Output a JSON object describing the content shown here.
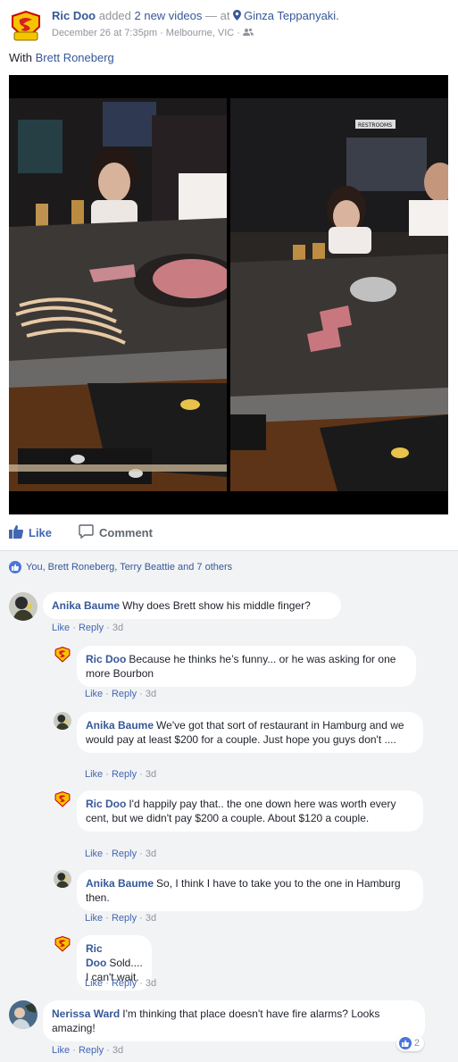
{
  "post": {
    "author": "Ric Doo",
    "action": " added ",
    "action_link": "2 new videos",
    "at_text": " — at ",
    "place": "Ginza Teppanyaki.",
    "date": "December 26 at 7:35pm",
    "sep1": " · ",
    "location": "Melbourne, VIC",
    "sep2": " · ",
    "with_prefix": "With ",
    "with_name": "Brett Roneberg",
    "photo_signs": [
      "RESTROOMS"
    ]
  },
  "actions": {
    "like_label": "Like",
    "comment_label": "Comment"
  },
  "reactions_summary": "You, Brett Roneberg, Terry Beattie and 7 others",
  "comments": [
    {
      "author": "Anika Baume",
      "text": "Why does Brett show his middle finger?",
      "like": "Like",
      "reply": "Reply",
      "time": "3d"
    },
    {
      "author": "Ric Doo",
      "text": "Because he thinks he’s funny... or he was asking for one more Bourbon",
      "like": "Like",
      "reply": "Reply",
      "time": "3d"
    },
    {
      "author": "Anika Baume",
      "text": "We've got that sort of restaurant in Hamburg and we would pay at least $200 for a couple. Just hope you guys don't ....",
      "like": "Like",
      "reply": "Reply",
      "time": "3d"
    },
    {
      "author": "Ric Doo",
      "text": "I'd happily pay that.. the one down here was worth every cent, but we didn't pay $200 a couple. About $120 a couple.",
      "like": "Like",
      "reply": "Reply",
      "time": "3d"
    },
    {
      "author": "Anika Baume",
      "text": "So, I think I have to take you to the one in Hamburg then.",
      "like": "Like",
      "reply": "Reply",
      "time": "3d"
    },
    {
      "author": "Ric Doo",
      "text": "Sold....",
      "text2": "I can't wait.",
      "like": "Like",
      "reply": "Reply",
      "time": "3d"
    },
    {
      "author": "Nerissa Ward",
      "text": "I'm thinking that place doesn't have fire alarms? Looks amazing!",
      "like": "Like",
      "reply": "Reply",
      "time": "3d",
      "reaction_count": "2"
    }
  ],
  "meta_sep": " · ",
  "colors": {
    "link": "#365899",
    "like_blue": "#4267b2",
    "meta_grey": "#90949c",
    "comments_bg": "#f2f3f5"
  },
  "icons": [
    "superman-avatar",
    "location-pin-icon",
    "friends-audience-icon",
    "like-thumb-icon",
    "comment-icon",
    "like-badge-icon"
  ]
}
